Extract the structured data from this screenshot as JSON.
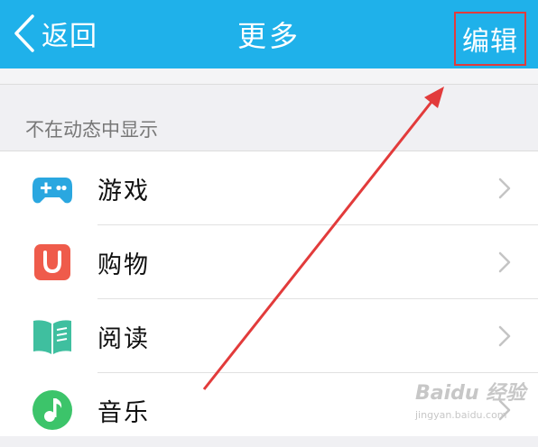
{
  "nav": {
    "back_label": "返回",
    "title": "更多",
    "edit_label": "编辑",
    "background": "#1fb1ea"
  },
  "section": {
    "header": "不在动态中显示",
    "items": [
      {
        "label": "游戏",
        "icon": "gamepad-icon",
        "color": "#2aa7e0"
      },
      {
        "label": "购物",
        "icon": "shopping-bag-icon",
        "color": "#ef5b4b"
      },
      {
        "label": "阅读",
        "icon": "open-book-icon",
        "color": "#3fbf9f"
      },
      {
        "label": "音乐",
        "icon": "music-note-icon",
        "color": "#3cc46a"
      }
    ]
  },
  "annotation": {
    "color": "#e23b3b"
  },
  "watermark": {
    "title": "Baidu 经验",
    "sub": "jingyan.baidu.com"
  }
}
